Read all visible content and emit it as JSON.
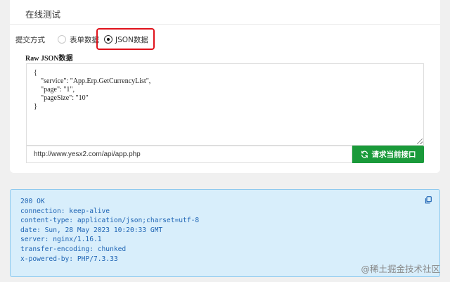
{
  "panel": {
    "title": "在线测试",
    "submit": {
      "label": "提交方式",
      "options": [
        {
          "label": "表单数据",
          "selected": false
        },
        {
          "label": "JSON数据",
          "selected": true
        }
      ]
    },
    "raw_label": "Raw JSON数据",
    "json_body": "{\n    \"service\": \"App.Erp.GetCurrencyList\",\n    \"page\": \"1\",\n    \"pageSize\": \"10\"\n}",
    "url": "http://www.yesx2.com/api/app.php",
    "request_button": "请求当前接口"
  },
  "response": {
    "lines": [
      "200 OK",
      "connection: keep-alive",
      "content-type: application/json;charset=utf-8",
      "date: Sun, 28 May 2023 10:20:33 GMT",
      "server: nginx/1.16.1",
      "transfer-encoding: chunked",
      "x-powered-by: PHP/7.3.33"
    ]
  },
  "watermark": "@稀土掘金技术社区",
  "colors": {
    "accent_green": "#1a9a3a",
    "highlight_red": "#e0121b",
    "response_bg": "#d8eefb",
    "response_text": "#1e64b4"
  },
  "icons": {
    "request_button": "refresh-icon",
    "response_copy": "copy-icon"
  }
}
